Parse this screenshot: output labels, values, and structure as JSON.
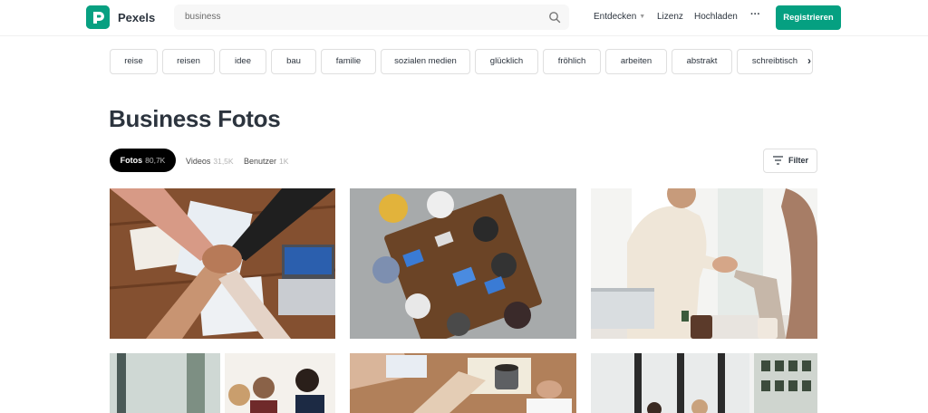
{
  "header": {
    "brand": "Pexels",
    "search_value": "business",
    "nav": {
      "explore": "Entdecken",
      "license": "Lizenz",
      "upload": "Hochladen",
      "more": "···"
    },
    "signup_label": "Registrieren",
    "accent_color": "#05a081"
  },
  "tags": [
    "reise",
    "reisen",
    "idee",
    "bau",
    "familie",
    "sozialen medien",
    "glücklich",
    "fröhlich",
    "arbeiten",
    "abstrakt",
    "schreibtisch"
  ],
  "page_title": "Business Fotos",
  "tabs": {
    "photos": {
      "label": "Fotos",
      "count": "80,7K"
    },
    "videos": {
      "label": "Videos",
      "count": "31,5K"
    },
    "users": {
      "label": "Benutzer",
      "count": "1K"
    }
  },
  "filter_label": "Filter",
  "icons": {
    "search": "search-icon",
    "chevron_down": "chevron-down-icon",
    "more": "more-icon",
    "next": "chevron-right-icon",
    "filter": "filter-icon"
  }
}
